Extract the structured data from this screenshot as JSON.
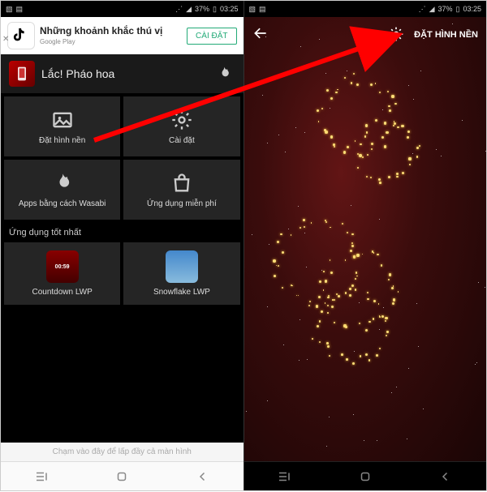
{
  "status": {
    "battery": "37%",
    "time": "03:25"
  },
  "ad": {
    "title": "Những khoảnh khắc thú vị",
    "sub": "Google Play",
    "cta": "CÀI ĐẶT"
  },
  "app": {
    "title": "Lắc! Pháo hoa"
  },
  "tiles": {
    "wallpaper": "Đặt hình nền",
    "settings": "Cài đặt",
    "wasabi": "Apps bằng cách Wasabi",
    "free": "Ứng dụng miễn phí"
  },
  "section_best": "Ứng dụng tốt nhất",
  "best_apps": {
    "countdown": {
      "label": "Countdown LWP",
      "thumb_text": "00:59"
    },
    "snowflake": {
      "label": "Snowflake LWP"
    }
  },
  "fill_hint": "Chạm vào đây để lấp đầy cả màn hình",
  "right": {
    "set_wallpaper": "ĐẶT HÌNH NỀN"
  }
}
